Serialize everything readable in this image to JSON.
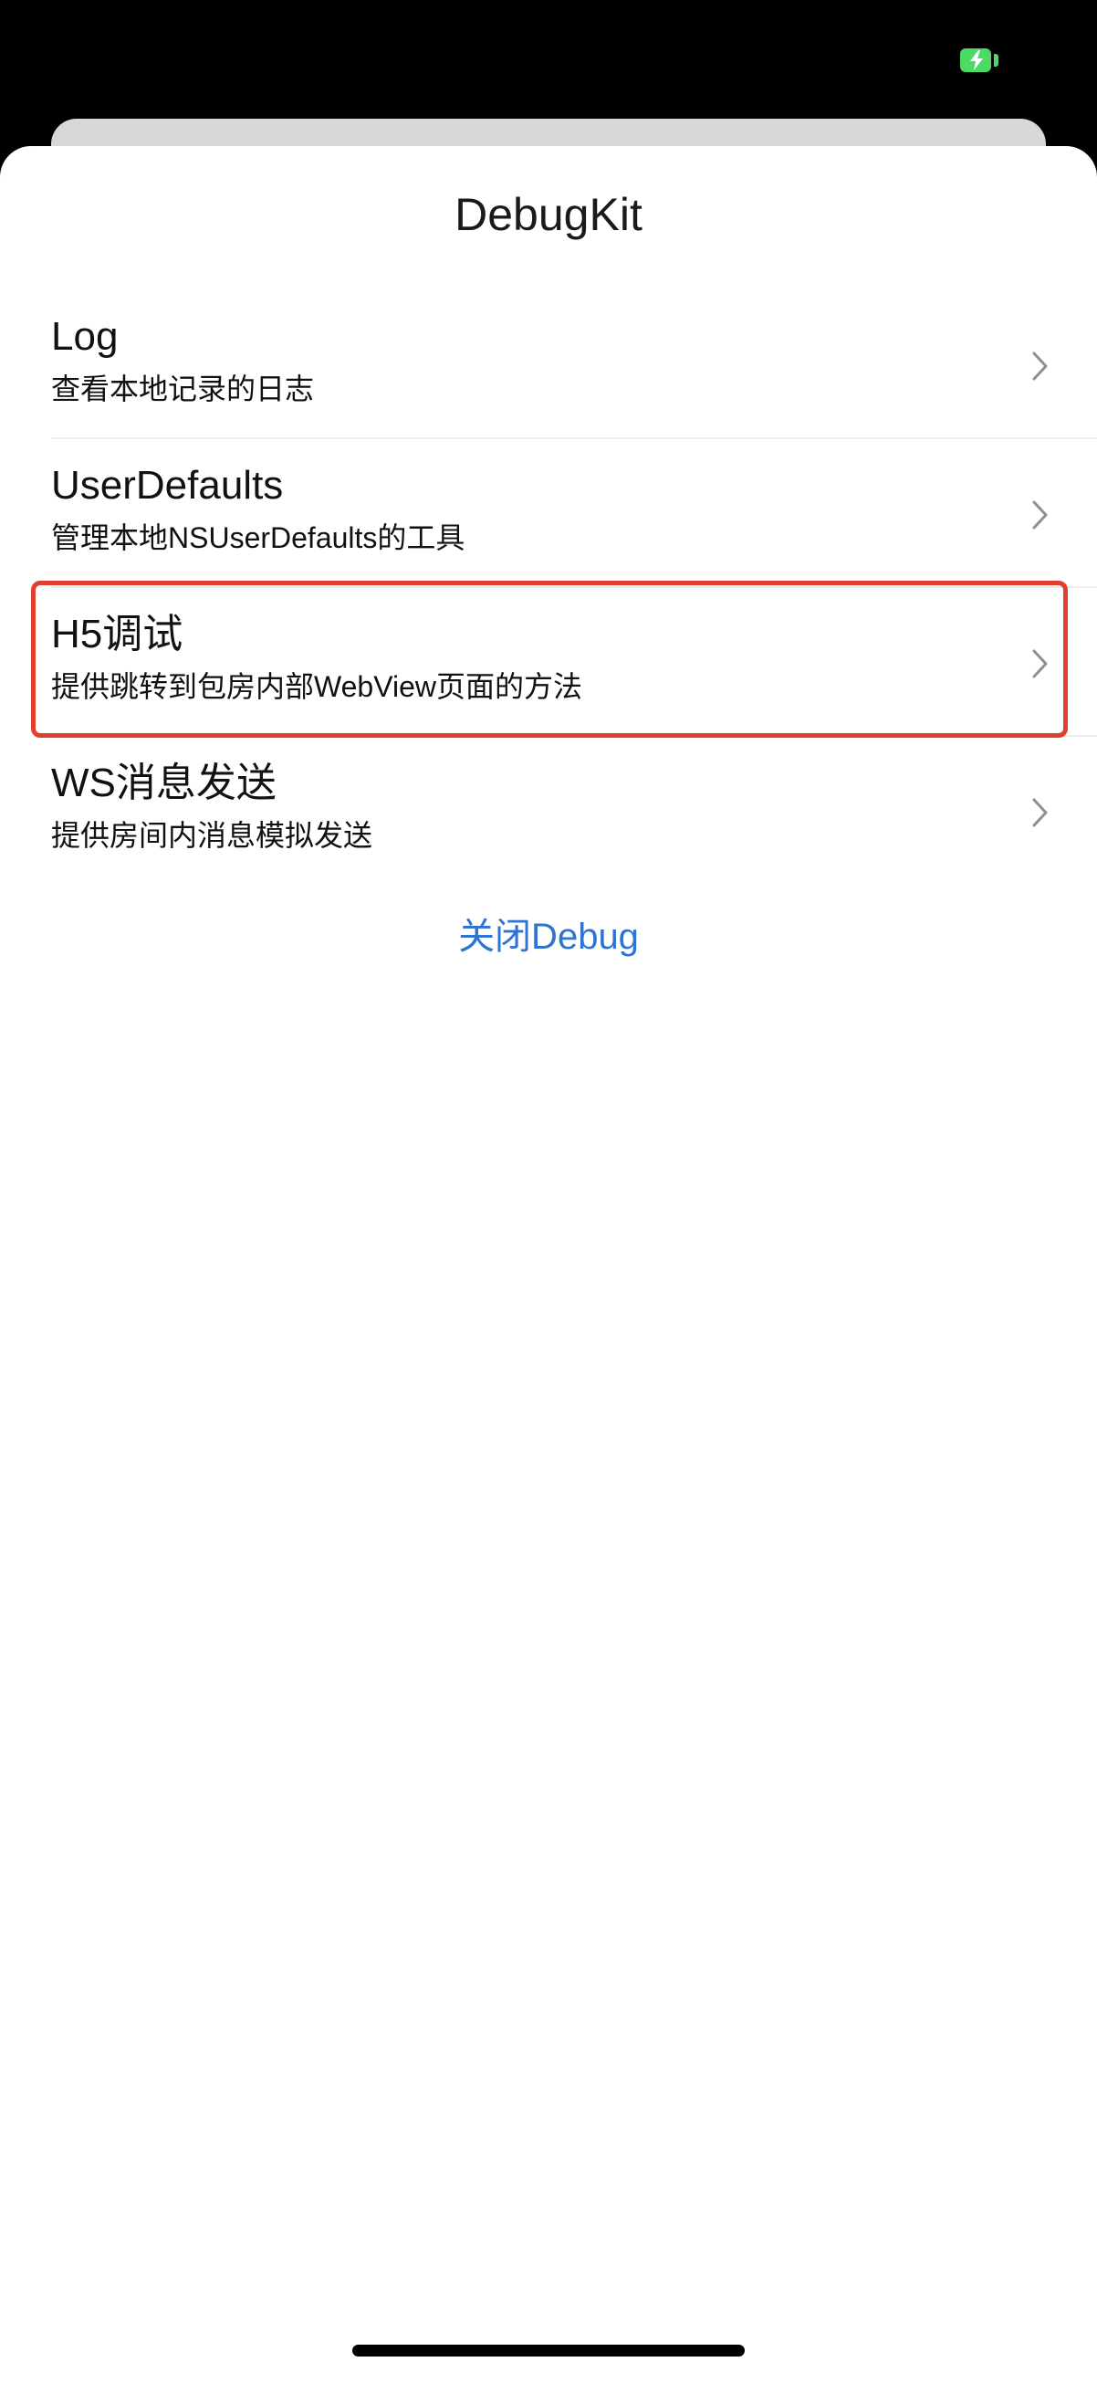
{
  "status_bar": {
    "battery_icon": "battery-charging-icon",
    "battery_color": "#4cd964"
  },
  "sheet": {
    "title": "DebugKit"
  },
  "menu": {
    "items": [
      {
        "title": "Log",
        "subtitle": "查看本地记录的日志",
        "icon": "chevron-right-icon"
      },
      {
        "title": "UserDefaults",
        "subtitle": "管理本地NSUserDefaults的工具",
        "icon": "chevron-right-icon"
      },
      {
        "title": "H5调试",
        "subtitle": "提供跳转到包房内部WebView页面的方法",
        "icon": "chevron-right-icon"
      },
      {
        "title": "WS消息发送",
        "subtitle": "提供房间内消息模拟发送",
        "icon": "chevron-right-icon"
      }
    ]
  },
  "close_button": {
    "label": "关闭Debug",
    "color": "#2f74d0"
  },
  "highlight": {
    "color": "#e0402f"
  }
}
